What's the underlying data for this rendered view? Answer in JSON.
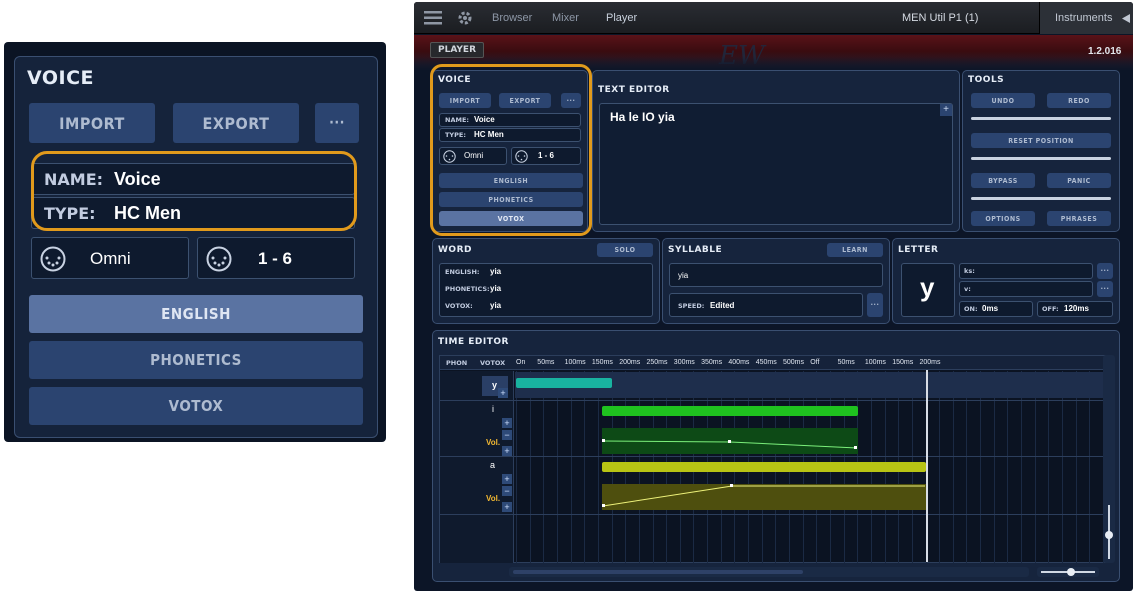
{
  "zoom": {
    "title": "VOICE",
    "import_label": "IMPORT",
    "export_label": "EXPORT",
    "more_label": "···",
    "name_label": "NAME:",
    "name_value": "Voice",
    "type_label": "TYPE:",
    "type_value": "HC Men",
    "midi_in": "Omni",
    "midi_channels": "1 - 6",
    "english_label": "ENGLISH",
    "phonetics_label": "PHONETICS",
    "votox_label": "VOTOX"
  },
  "topbar": {
    "tabs": [
      "Browser",
      "Mixer",
      "Player"
    ],
    "preset_name": "MEN Util P1 (1)",
    "instruments_label": "Instruments"
  },
  "header": {
    "player_label": "PLAYER",
    "logo": "EW",
    "version": "1.2.016"
  },
  "voice": {
    "title": "VOICE",
    "import_label": "IMPORT",
    "export_label": "EXPORT",
    "more_label": "···",
    "name_label": "NAME:",
    "name_value": "Voice",
    "type_label": "TYPE:",
    "type_value": "HC Men",
    "midi_in": "Omni",
    "midi_channels": "1 - 6",
    "english_label": "ENGLISH",
    "phonetics_label": "PHONETICS",
    "votox_label": "VOTOX"
  },
  "text_editor": {
    "title": "TEXT EDITOR",
    "content": "Ha le IO yia",
    "plus": "+"
  },
  "tools": {
    "title": "TOOLS",
    "undo": "UNDO",
    "redo": "REDO",
    "reset_position": "RESET POSITION",
    "bypass": "BYPASS",
    "panic": "PANIC",
    "options": "OPTIONS",
    "phrases": "PHRASES"
  },
  "word": {
    "title": "WORD",
    "solo": "SOLO",
    "english_label": "ENGLISH:",
    "english_value": "yia",
    "phonetics_label": "PHONETICS:",
    "phonetics_value": "yia",
    "votox_label": "VOTOX:",
    "votox_value": "yia"
  },
  "syllable": {
    "title": "SYLLABLE",
    "learn": "LEARN",
    "value": "yia",
    "speed_label": "SPEED:",
    "speed_value": "Edited",
    "more": "···"
  },
  "letter": {
    "title": "LETTER",
    "letter": "y",
    "ks_label": "ks:",
    "v_label": "v:",
    "on_label": "ON:",
    "on_value": "0ms",
    "off_label": "OFF:",
    "off_value": "120ms",
    "more": "···"
  },
  "time_editor": {
    "title": "TIME EDITOR",
    "phon_label": "PHON",
    "votox_label": "VOTOX",
    "ruler": [
      "On",
      "50ms",
      "100ms",
      "150ms",
      "200ms",
      "250ms",
      "300ms",
      "350ms",
      "400ms",
      "450ms",
      "500ms",
      "Off",
      "50ms",
      "100ms",
      "150ms",
      "200ms"
    ],
    "rows": [
      {
        "phoneme": "y",
        "color": "#19b3a0"
      },
      {
        "phoneme": "i",
        "color": "#1fc21f",
        "vol_label": "Vol."
      },
      {
        "phoneme": "a",
        "color": "#b8c414",
        "vol_label": "Vol."
      }
    ]
  },
  "colors": {
    "accent_orange": "#e19a1c",
    "button_blue": "#2b4470",
    "selected_votox": "#5a73a2",
    "phoneme_y": "#19b3a0",
    "phoneme_i": "#1fc21f",
    "phoneme_a": "#b8c414"
  }
}
